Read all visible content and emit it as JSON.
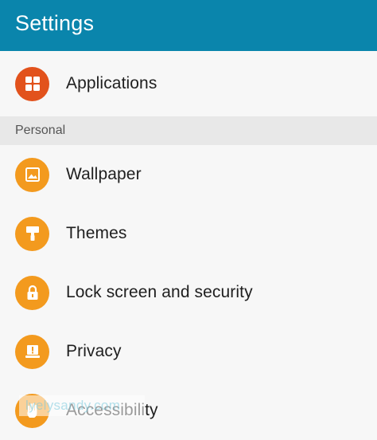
{
  "header": {
    "title": "Settings",
    "bar_color": "#0a85ac"
  },
  "items_top": [
    {
      "label": "Applications",
      "icon": "grid-icon",
      "color": "#e2521c"
    }
  ],
  "section": {
    "label": "Personal"
  },
  "items_personal": [
    {
      "label": "Wallpaper",
      "icon": "image-icon",
      "color": "#f39a1e"
    },
    {
      "label": "Themes",
      "icon": "paint-roller-icon",
      "color": "#f39a1e"
    },
    {
      "label": "Lock screen and security",
      "icon": "lock-icon",
      "color": "#f39a1e"
    },
    {
      "label": "Privacy",
      "icon": "privacy-alert-icon",
      "color": "#f39a1e"
    },
    {
      "label": "Accessibility",
      "icon": "hand-icon",
      "color": "#f39a1e"
    }
  ],
  "watermark": {
    "text": "lyelysandy.com"
  }
}
